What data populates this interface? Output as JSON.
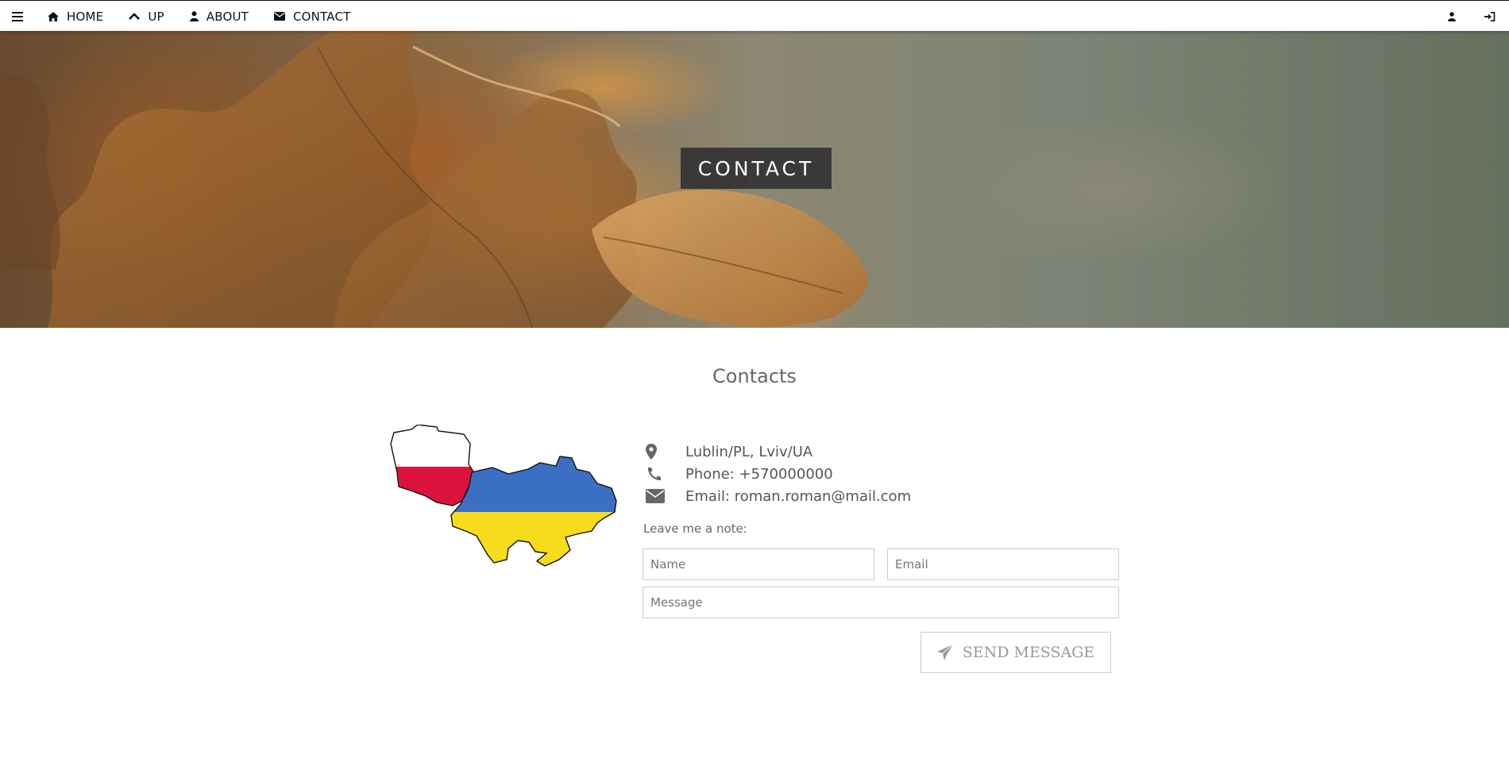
{
  "nav": {
    "items": [
      {
        "label": "HOME",
        "icon": "home-icon"
      },
      {
        "label": "UP",
        "icon": "chevron-up-icon"
      },
      {
        "label": "ABOUT",
        "icon": "user-icon"
      },
      {
        "label": "CONTACT",
        "icon": "envelope-icon"
      }
    ],
    "right_icons": [
      "user-icon",
      "sign-in-icon"
    ]
  },
  "hero": {
    "title": "CONTACT"
  },
  "contacts": {
    "title": "Contacts",
    "location": "Lublin/PL, Lviv/UA",
    "phone": "Phone: +570000000",
    "email": "Email: roman.roman@mail.com",
    "map_flags": {
      "poland": [
        "#ffffff",
        "#dc143c"
      ],
      "ukraine": [
        "#3b6fc4",
        "#f7dc1e"
      ]
    }
  },
  "form": {
    "note_label": "Leave me a note:",
    "name_placeholder": "Name",
    "email_placeholder": "Email",
    "message_placeholder": "Message",
    "send_label": "SEND MESSAGE"
  }
}
